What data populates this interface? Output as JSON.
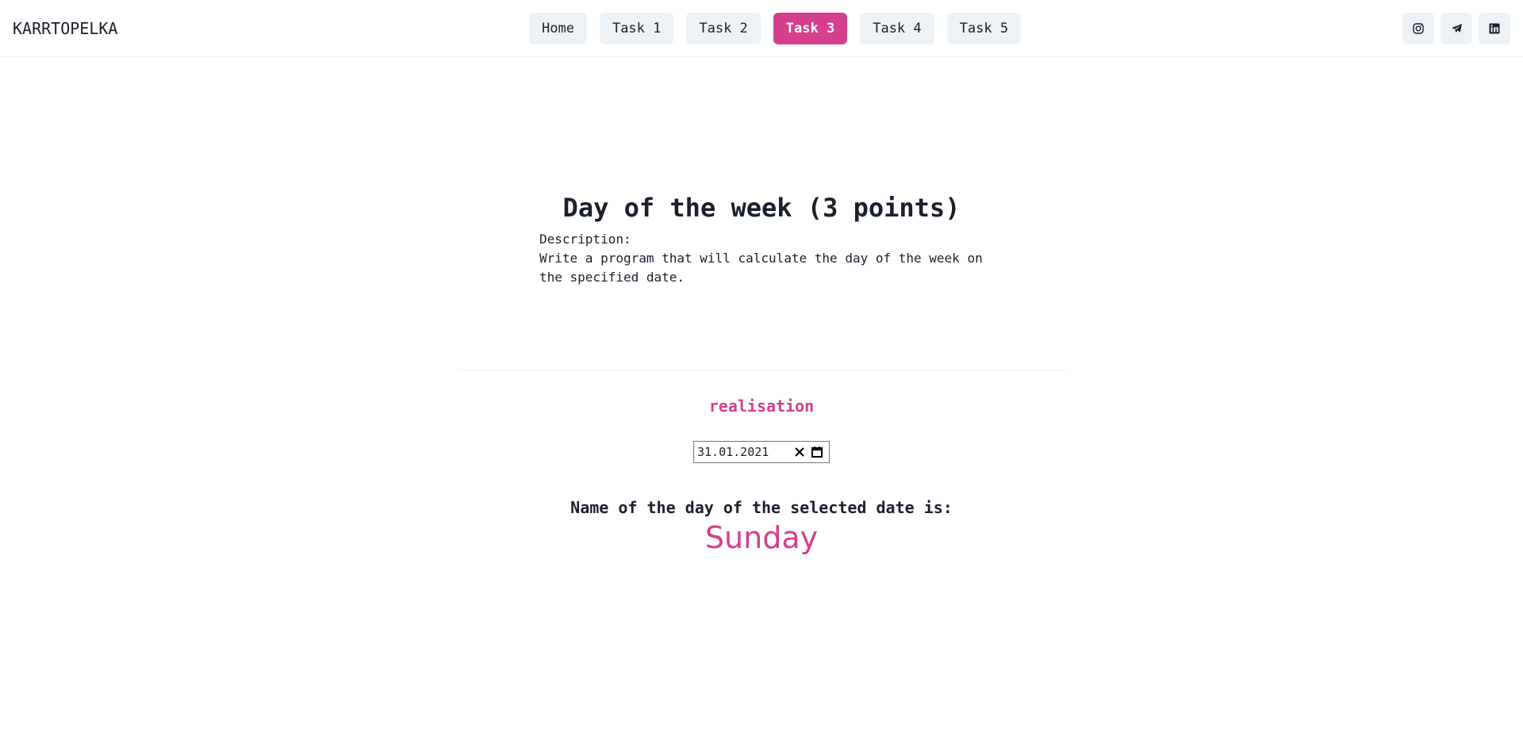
{
  "header": {
    "brand": "KARRTOPELKA",
    "nav": [
      {
        "label": "Home",
        "active": false
      },
      {
        "label": "Task 1",
        "active": false
      },
      {
        "label": "Task 2",
        "active": false
      },
      {
        "label": "Task 3",
        "active": true
      },
      {
        "label": "Task 4",
        "active": false
      },
      {
        "label": "Task 5",
        "active": false
      }
    ],
    "socials": [
      {
        "icon": "instagram-icon"
      },
      {
        "icon": "telegram-icon"
      },
      {
        "icon": "linkedin-icon"
      }
    ]
  },
  "task": {
    "title": "Day of the week (3 points)",
    "description_label": "Description:",
    "description_text": "Write a program that will calculate the day of the week on the specified date.",
    "realisation_heading": "realisation",
    "date_value": "31.01.2021",
    "result_label": "Name of the day of the selected date is:",
    "result_value": "Sunday"
  },
  "colors": {
    "accent": "#d53f8c",
    "button_bg": "#edf2f7",
    "text": "#1a202c"
  }
}
